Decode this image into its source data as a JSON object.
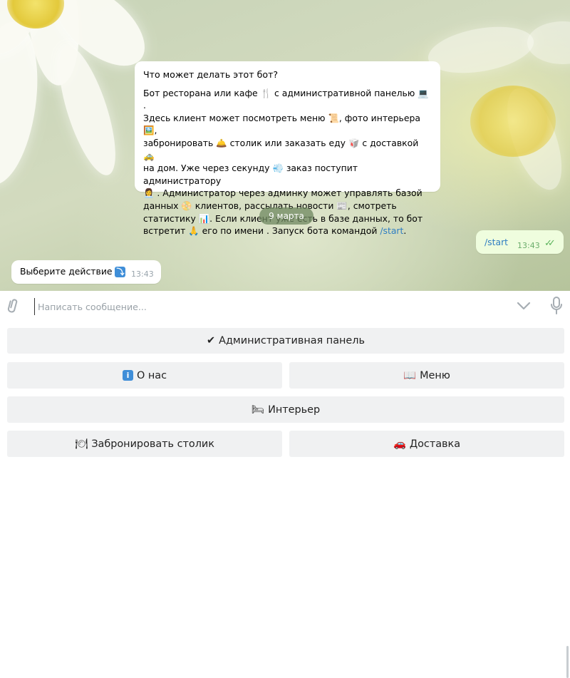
{
  "bot_info": {
    "title": "Что может делать этот бот?",
    "line1a": "Бот ресторана или кафе ",
    "line1b": " с административной панелью ",
    "line1c": " .",
    "line2a": "Здесь клиент может посмотреть меню ",
    "line2b": ", фото интерьера ",
    "line2c": ",",
    "line3a": "забронировать ",
    "line3b": " столик  или заказать еду ",
    "line3c": " с доставкой ",
    "line4a": "на дом. Уже через секунду  ",
    "line4b": " заказ поступит администратору",
    "line5a": " . Администратор через админку может управлять базой",
    "line6a": "данных ",
    "line6b": " клиентов, рассылать новости ",
    "line6c": ", смотреть",
    "line7a": "статистику ",
    "line7b": ". Если клиент уже есть в базе данных, то бот",
    "line8a": "встретит ",
    "line8b": " его по имени . Запуск бота командой ",
    "command": "/start",
    "line8c": "."
  },
  "date_chip": "9 марта",
  "outgoing": {
    "text": "/start",
    "time": "13:43"
  },
  "incoming": {
    "text": "Выберите действие",
    "time": "13:43"
  },
  "composer": {
    "placeholder": "Написать сообщение..."
  },
  "keyboard": {
    "admin": "Административная панель",
    "about": "О нас",
    "menu": "Меню",
    "interior": "Интерьер",
    "book": "Забронировать столик",
    "delivery": "Доставка"
  },
  "icons": [
    "paperclip-icon",
    "chevron-down-icon",
    "microphone-icon",
    "double-check-icon"
  ]
}
